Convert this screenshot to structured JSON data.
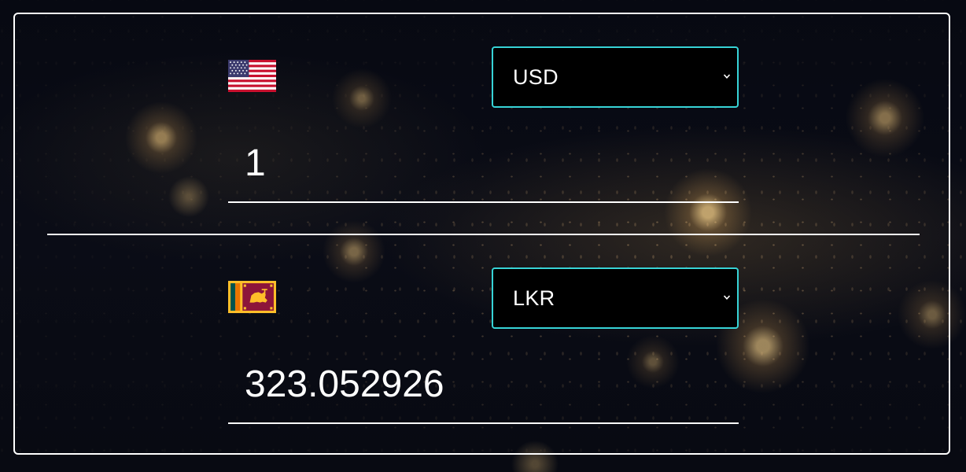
{
  "from": {
    "flag_icon": "us-flag-icon",
    "currency": "USD",
    "amount": "1"
  },
  "to": {
    "flag_icon": "sri-lanka-flag-icon",
    "currency": "LKR",
    "amount": "323.052926"
  },
  "colors": {
    "accent": "#37d3d6",
    "text": "#ffffff",
    "select_background": "#000000"
  },
  "icons": [
    "us-flag-icon",
    "sri-lanka-flag-icon",
    "chevron-down-icon"
  ]
}
